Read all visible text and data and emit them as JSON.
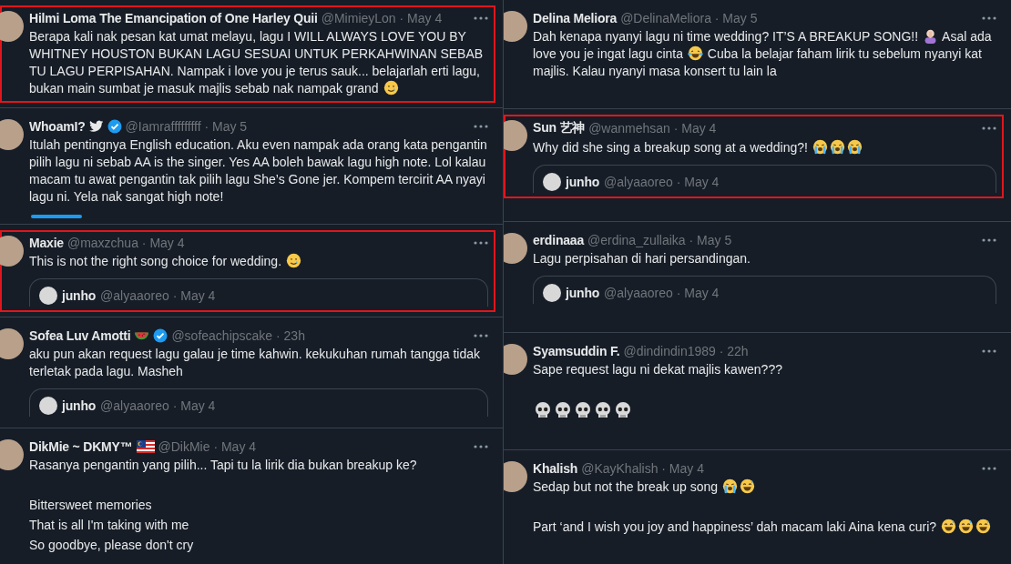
{
  "columns": [
    {
      "cells": [
        {
          "name": "Hilmi Loma The Emancipation of One Harley Quii",
          "meta": "@MimieyLon · May 4",
          "highlighted": true,
          "paragraphs": [
            {
              "kind": "para",
              "parts": [
                {
                  "kind": "text",
                  "t": "Berapa kali nak pesan kat umat melayu, lagu I WILL ALWAYS LOVE YOU BY WHITNEY HOUSTON BUKAN LAGU SESUAI UNTUK PERKAHWINAN SEBAB TU LAGU PERPISAHAN. Nampak i love you je terus sauk... belajarlah erti lagu, bukan main sumbat je masuk majlis sebab nak nampak grand "
                },
                {
                  "kind": "smiletear"
                }
              ]
            }
          ]
        },
        {
          "name": "WhoamI?",
          "badges": [
            {
              "kind": "bird"
            },
            {
              "kind": "verified"
            }
          ],
          "meta": "@Iamrafffffffff · May 5",
          "highlighted": false,
          "tab_indicator": true,
          "paragraphs": [
            {
              "kind": "para",
              "parts": [
                {
                  "kind": "text",
                  "t": "Itulah pentingnya English education. Aku even nampak ada orang kata pengantin pilih lagu ni sebab AA is the singer. Yes AA boleh bawak lagu high note. Lol kalau macam tu awat pengantin tak pilih lagu She’s Gone jer. Kompem tercirit AA nyayi lagu ni. Yela nak sangat high note!"
                }
              ]
            }
          ]
        },
        {
          "name": "Maxie",
          "meta": "@maxzchua · May 4",
          "highlighted": true,
          "paragraphs": [
            {
              "kind": "para",
              "parts": [
                {
                  "kind": "text",
                  "t": "This is not the right song choice for wedding. "
                },
                {
                  "kind": "smiletear"
                }
              ]
            }
          ],
          "quote": {
            "name": "junho",
            "meta": "@alyaaoreo · May 4"
          }
        },
        {
          "name": "Sofea Luv Amotti",
          "badges": [
            {
              "kind": "watermelon"
            },
            {
              "kind": "verified"
            }
          ],
          "meta": "@sofeachipscake · 23h",
          "highlighted": false,
          "paragraphs": [
            {
              "kind": "para",
              "parts": [
                {
                  "kind": "text",
                  "t": "aku pun akan request lagu galau je time kahwin. kekukuhan rumah tangga tidak terletak pada lagu. Masheh"
                }
              ]
            }
          ],
          "quote": {
            "name": "junho",
            "meta": "@alyaaoreo · May 4"
          }
        },
        {
          "name": "DikMie ~ DKMY™",
          "badges": [
            {
              "kind": "flag"
            }
          ],
          "meta": "@DikMie · May 4",
          "highlighted": false,
          "paragraphs": [
            {
              "kind": "para",
              "parts": [
                {
                  "kind": "text",
                  "t": "Rasanya pengantin yang pilih... Tapi tu la lirik dia bukan breakup ke?"
                }
              ]
            },
            {
              "kind": "blank"
            },
            {
              "kind": "para",
              "parts": [
                {
                  "kind": "text",
                  "t": "Bittersweet memories"
                }
              ]
            },
            {
              "kind": "para",
              "parts": [
                {
                  "kind": "text",
                  "t": "That is all I'm taking with me"
                }
              ]
            },
            {
              "kind": "para",
              "parts": [
                {
                  "kind": "text",
                  "t": "So goodbye, please don't cry"
                }
              ]
            }
          ]
        }
      ]
    },
    {
      "cells": [
        {
          "name": "Delina Meliora",
          "meta": "@DelinaMeliora · May 5",
          "highlighted": false,
          "paragraphs": [
            {
              "kind": "para",
              "parts": [
                {
                  "kind": "text",
                  "t": "Dah kenapa nyanyi lagu ni time wedding? IT’S A BREAKUP SONG!! "
                },
                {
                  "kind": "facepalm"
                },
                {
                  "kind": "text",
                  "t": " Asal ada love you je ingat lagu cinta "
                },
                {
                  "kind": "joy"
                },
                {
                  "kind": "text",
                  "t": " Cuba la belajar faham lirik tu sebelum nyanyi kat majlis. Kalau nyanyi masa konsert tu lain la"
                }
              ]
            }
          ]
        },
        {
          "name": "Sun 艺神",
          "meta": "@wanmehsan · May 4",
          "highlighted": true,
          "paragraphs": [
            {
              "kind": "para",
              "parts": [
                {
                  "kind": "text",
                  "t": "Why did she sing a breakup song at a wedding?! "
                },
                {
                  "kind": "sob"
                },
                {
                  "kind": "sob"
                },
                {
                  "kind": "sob"
                }
              ]
            }
          ],
          "quote": {
            "name": "junho",
            "meta": "@alyaaoreo · May 4"
          }
        },
        {
          "name": "erdinaaa",
          "meta": "@erdina_zullaika · May 5",
          "highlighted": false,
          "paragraphs": [
            {
              "kind": "para",
              "parts": [
                {
                  "kind": "text",
                  "t": "Lagu perpisahan di hari persandingan."
                }
              ]
            }
          ],
          "quote": {
            "name": "junho",
            "meta": "@alyaaoreo · May 4"
          }
        },
        {
          "name": "Syamsuddin F.",
          "meta": "@dindindin1989 · 22h",
          "highlighted": false,
          "paragraphs": [
            {
              "kind": "para",
              "parts": [
                {
                  "kind": "text",
                  "t": "Sape request lagu ni dekat majlis kawen???"
                }
              ]
            },
            {
              "kind": "blank"
            },
            {
              "kind": "para",
              "parts": [
                {
                  "kind": "skull"
                },
                {
                  "kind": "skull"
                },
                {
                  "kind": "skull"
                },
                {
                  "kind": "skull"
                },
                {
                  "kind": "skull"
                }
              ]
            }
          ]
        },
        {
          "name": "Khalish",
          "meta": "@KayKhalish · May 4",
          "highlighted": false,
          "paragraphs": [
            {
              "kind": "para",
              "parts": [
                {
                  "kind": "text",
                  "t": "Sedap but not the break up song "
                },
                {
                  "kind": "sob"
                },
                {
                  "kind": "sweatsmile"
                }
              ]
            },
            {
              "kind": "blank"
            },
            {
              "kind": "para",
              "parts": [
                {
                  "kind": "text",
                  "t": "Part ‘and I wish you joy and happiness’ dah macam laki Aina kena curi? "
                },
                {
                  "kind": "sweatsmile"
                },
                {
                  "kind": "sweatsmile"
                },
                {
                  "kind": "sweatsmile"
                }
              ]
            }
          ]
        }
      ]
    }
  ]
}
